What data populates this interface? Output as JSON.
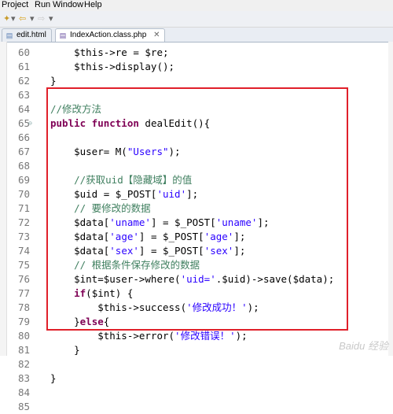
{
  "menu": [
    "Project",
    "Run",
    "Window",
    "Help"
  ],
  "tabs": [
    {
      "label": "edit.html",
      "active": false
    },
    {
      "label": "IndexAction.class.php",
      "active": true
    }
  ],
  "lines": [
    {
      "n": "60",
      "segs": [
        {
          "t": "        $this->re = $re;",
          "c": "var"
        }
      ]
    },
    {
      "n": "61",
      "segs": [
        {
          "t": "        $this->display();",
          "c": "var"
        }
      ]
    },
    {
      "n": "62",
      "segs": [
        {
          "t": "    }",
          "c": "var"
        }
      ]
    },
    {
      "n": "63",
      "segs": []
    },
    {
      "n": "64",
      "segs": [
        {
          "t": "    //修改方法",
          "c": "cmt"
        }
      ]
    },
    {
      "n": "65",
      "fold": true,
      "segs": [
        {
          "t": "    ",
          "c": "var"
        },
        {
          "t": "public function",
          "c": "kw"
        },
        {
          "t": " dealEdit(){",
          "c": "var"
        }
      ]
    },
    {
      "n": "66",
      "segs": []
    },
    {
      "n": "67",
      "segs": [
        {
          "t": "        $user= M(",
          "c": "var"
        },
        {
          "t": "\"Users\"",
          "c": "str"
        },
        {
          "t": ");",
          "c": "var"
        }
      ]
    },
    {
      "n": "68",
      "segs": []
    },
    {
      "n": "69",
      "segs": [
        {
          "t": "        //获取uid【隐藏域】的值",
          "c": "cmt"
        }
      ]
    },
    {
      "n": "70",
      "segs": [
        {
          "t": "        $uid = $_POST[",
          "c": "var"
        },
        {
          "t": "'uid'",
          "c": "str"
        },
        {
          "t": "];",
          "c": "var"
        }
      ]
    },
    {
      "n": "71",
      "segs": [
        {
          "t": "        // 要修改的数据",
          "c": "cmt"
        }
      ]
    },
    {
      "n": "72",
      "segs": [
        {
          "t": "        $data[",
          "c": "var"
        },
        {
          "t": "'uname'",
          "c": "str"
        },
        {
          "t": "] = $_POST[",
          "c": "var"
        },
        {
          "t": "'uname'",
          "c": "str"
        },
        {
          "t": "];",
          "c": "var"
        }
      ]
    },
    {
      "n": "73",
      "segs": [
        {
          "t": "        $data[",
          "c": "var"
        },
        {
          "t": "'age'",
          "c": "str"
        },
        {
          "t": "] = $_POST[",
          "c": "var"
        },
        {
          "t": "'age'",
          "c": "str"
        },
        {
          "t": "];",
          "c": "var"
        }
      ]
    },
    {
      "n": "74",
      "segs": [
        {
          "t": "        $data[",
          "c": "var"
        },
        {
          "t": "'sex'",
          "c": "str"
        },
        {
          "t": "] = $_POST[",
          "c": "var"
        },
        {
          "t": "'sex'",
          "c": "str"
        },
        {
          "t": "];",
          "c": "var"
        }
      ]
    },
    {
      "n": "75",
      "segs": [
        {
          "t": "        // 根据条件保存修改的数据",
          "c": "cmt"
        }
      ]
    },
    {
      "n": "76",
      "segs": [
        {
          "t": "        $int=$user->where(",
          "c": "var"
        },
        {
          "t": "'uid='",
          "c": "str"
        },
        {
          "t": ".$uid)->save($data);",
          "c": "var"
        }
      ]
    },
    {
      "n": "77",
      "segs": [
        {
          "t": "        ",
          "c": "var"
        },
        {
          "t": "if",
          "c": "kw"
        },
        {
          "t": "($int) {",
          "c": "var"
        }
      ]
    },
    {
      "n": "78",
      "segs": [
        {
          "t": "            $this->success(",
          "c": "var"
        },
        {
          "t": "'修改成功！'",
          "c": "str"
        },
        {
          "t": ");",
          "c": "var"
        }
      ]
    },
    {
      "n": "79",
      "segs": [
        {
          "t": "        }",
          "c": "var"
        },
        {
          "t": "else",
          "c": "kw"
        },
        {
          "t": "{",
          "c": "var"
        }
      ]
    },
    {
      "n": "80",
      "segs": [
        {
          "t": "            $this->error(",
          "c": "var"
        },
        {
          "t": "'修改错误！'",
          "c": "str"
        },
        {
          "t": ");",
          "c": "var"
        }
      ]
    },
    {
      "n": "81",
      "segs": [
        {
          "t": "        }",
          "c": "var"
        }
      ]
    },
    {
      "n": "82",
      "segs": []
    },
    {
      "n": "83",
      "segs": [
        {
          "t": "    }",
          "c": "var"
        }
      ]
    },
    {
      "n": "84",
      "segs": []
    },
    {
      "n": "85",
      "segs": []
    }
  ],
  "watermark": "Baidu 经验",
  "colors": {
    "highlight_border": "#e0202a",
    "keyword": "#7f0055",
    "string": "#2a00ff",
    "comment": "#3f7f5f"
  }
}
